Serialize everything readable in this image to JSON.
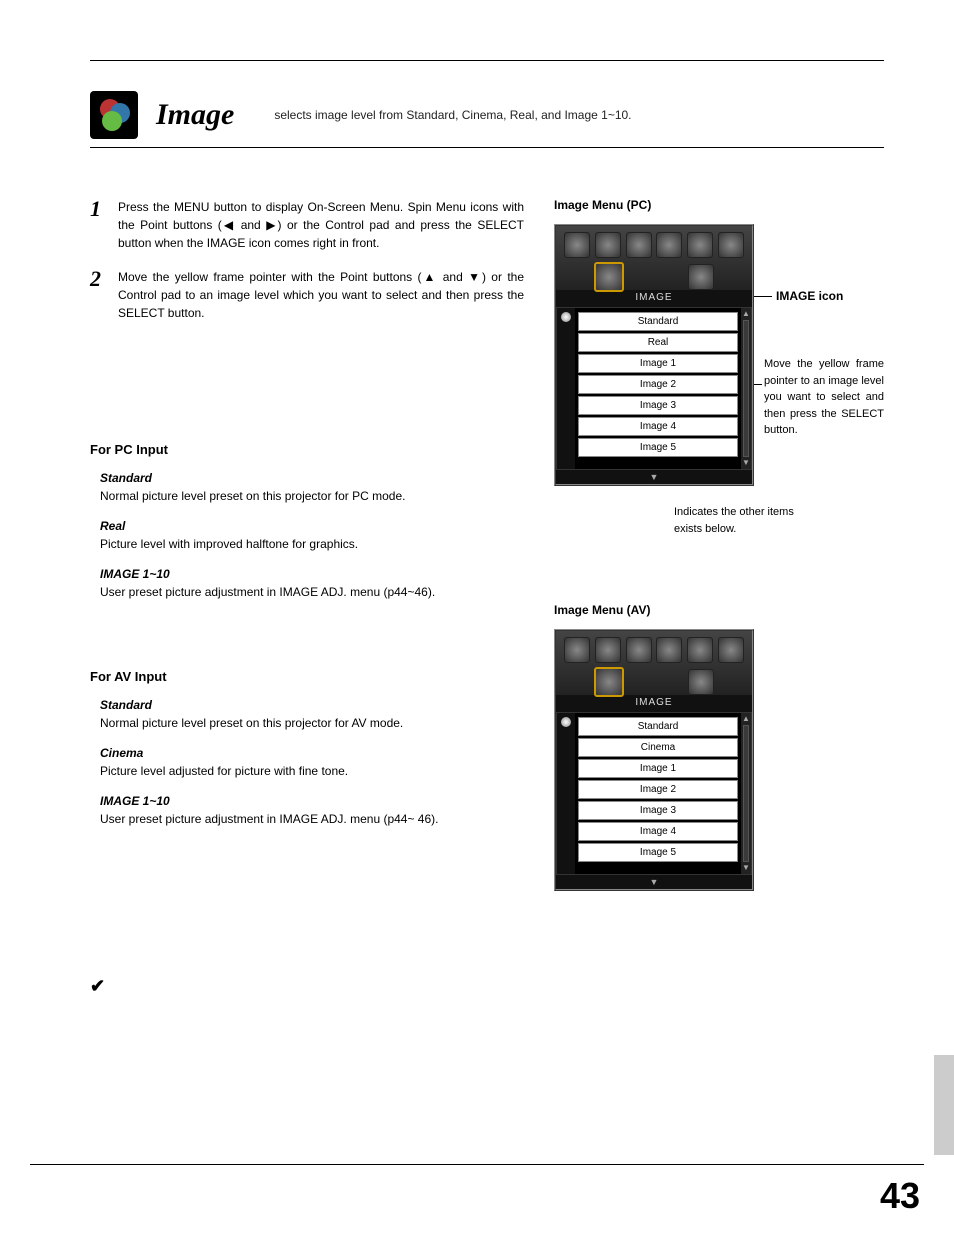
{
  "header": {
    "title": "Image",
    "subtitle": "selects image level from Standard, Cinema, Real, and Image 1~10."
  },
  "steps": [
    {
      "num": "1",
      "text": "Press the MENU button to display On-Screen Menu. Spin Menu icons with the Point buttons (◀ and ▶) or the Control pad and press the SELECT button when the IMAGE icon comes right in front."
    },
    {
      "num": "2",
      "text": "Move the yellow frame pointer with the Point buttons (▲ and ▼) or the Control pad to an image level which you want to select and then press the SELECT button."
    }
  ],
  "pc_section": {
    "heading": "For PC Input",
    "defs": [
      {
        "term": "Standard",
        "body": "Normal picture level preset on this projector for PC mode."
      },
      {
        "term": "Real",
        "body": "Picture level with improved halftone for graphics."
      },
      {
        "term": "IMAGE 1~10",
        "body": "User preset picture adjustment in IMAGE ADJ. menu (p44~46)."
      }
    ]
  },
  "av_section": {
    "heading": "For AV Input",
    "defs": [
      {
        "term": "Standard",
        "body": "Normal picture level preset on this projector for AV mode."
      },
      {
        "term": "Cinema",
        "body": "Picture level adjusted for picture with fine tone."
      },
      {
        "term": "IMAGE 1~10",
        "body": "User preset picture adjustment in IMAGE ADJ. menu (p44~ 46)."
      }
    ]
  },
  "menu_pc": {
    "heading": "Image Menu (PC)",
    "label": "IMAGE",
    "items": [
      "Standard",
      "Real",
      "Image 1",
      "Image 2",
      "Image 3",
      "Image 4",
      "Image 5"
    ],
    "callout_icon": "IMAGE icon",
    "callout_frame": "Move the  yellow frame pointer to an image level you want to select and then press the SELECT button.",
    "indicator": "Indicates the other items exists below."
  },
  "menu_av": {
    "heading": "Image Menu (AV)",
    "label": "IMAGE",
    "items": [
      "Standard",
      "Cinema",
      "Image 1",
      "Image 2",
      "Image 3",
      "Image 4",
      "Image 5"
    ]
  },
  "page_number": "43"
}
